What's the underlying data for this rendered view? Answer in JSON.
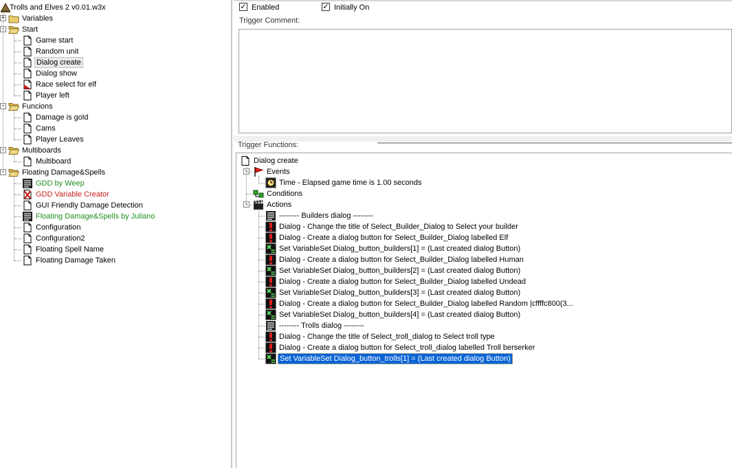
{
  "tree": {
    "root": "Trolls and Elves 2 v0.01.w3x",
    "items": [
      {
        "label": "Variables",
        "icon": "folder-icon",
        "depth": 1,
        "expander": "+"
      },
      {
        "label": "Start",
        "icon": "folder-open-icon",
        "depth": 1,
        "expander": "-"
      },
      {
        "label": "Game start",
        "icon": "document-icon",
        "depth": 2
      },
      {
        "label": "Random unit",
        "icon": "document-icon",
        "depth": 2
      },
      {
        "label": "Dialog create",
        "icon": "document-icon",
        "depth": 2,
        "selected": true
      },
      {
        "label": "Dialog show",
        "icon": "document-icon",
        "depth": 2
      },
      {
        "label": "Race select for elf",
        "icon": "document-disabled-icon",
        "depth": 2
      },
      {
        "label": "Player left",
        "icon": "document-icon",
        "depth": 2
      },
      {
        "label": "Funcions",
        "icon": "folder-open-icon",
        "depth": 1,
        "expander": "-"
      },
      {
        "label": "Damage is gold",
        "icon": "document-icon",
        "depth": 2
      },
      {
        "label": "Cams",
        "icon": "document-icon",
        "depth": 2
      },
      {
        "label": "Player Leaves",
        "icon": "document-icon",
        "depth": 2
      },
      {
        "label": "Multiboards",
        "icon": "folder-open-icon",
        "depth": 1,
        "expander": "-"
      },
      {
        "label": "Multiboard",
        "icon": "document-icon",
        "depth": 2
      },
      {
        "label": "Floating Damage&Spells",
        "icon": "folder-open-icon",
        "depth": 1,
        "expander": "-"
      },
      {
        "label": "GDD by Weep",
        "icon": "comment-lines-icon",
        "depth": 2,
        "color": "green"
      },
      {
        "label": "GDD Variable Creator",
        "icon": "disabled-trigger-icon",
        "depth": 2,
        "color": "red"
      },
      {
        "label": "GUI Friendly Damage Detection",
        "icon": "document-icon",
        "depth": 2
      },
      {
        "label": "Floating Damage&Spells by Juliano",
        "icon": "comment-lines-icon",
        "depth": 2,
        "color": "green"
      },
      {
        "label": "Configuration",
        "icon": "document-icon",
        "depth": 2
      },
      {
        "label": "Configuration2",
        "icon": "document-icon",
        "depth": 2
      },
      {
        "label": "Floating Spell Name",
        "icon": "document-icon",
        "depth": 2
      },
      {
        "label": "Floating Damage Taken",
        "icon": "document-icon",
        "depth": 2
      }
    ]
  },
  "options": {
    "enabled_label": "Enabled",
    "enabled": true,
    "initially_on_label": "Initially On",
    "initially_on": true
  },
  "comment": {
    "label": "Trigger Comment:",
    "value": ""
  },
  "functions": {
    "label": "Trigger Functions:",
    "rows": [
      {
        "label": "Dialog create",
        "icon": "document-icon",
        "depth": 0
      },
      {
        "label": "Events",
        "icon": "flag-icon",
        "depth": 1,
        "expander": "-"
      },
      {
        "label": "Time - Elapsed game time is 1.00 seconds",
        "icon": "clock-icon",
        "depth": 2
      },
      {
        "label": "Conditions",
        "icon": "conditions-icon",
        "depth": 1
      },
      {
        "label": "Actions",
        "icon": "clapper-icon",
        "depth": 1,
        "expander": "-"
      },
      {
        "label": "-------- Builders dialog --------",
        "icon": "comment-lines-icon",
        "depth": 2
      },
      {
        "label": "Dialog - Change the title of Select_Builder_Dialog to Select your builder",
        "icon": "exclamation-icon",
        "depth": 2
      },
      {
        "label": "Dialog - Create a dialog button for Select_Builder_Dialog labelled Elf",
        "icon": "exclamation-icon",
        "depth": 2
      },
      {
        "label": "Set VariableSet Dialog_button_builders[1] = (Last created dialog Button)",
        "icon": "set-variable-icon",
        "depth": 2
      },
      {
        "label": "Dialog - Create a dialog button for Select_Builder_Dialog labelled Human",
        "icon": "exclamation-icon",
        "depth": 2
      },
      {
        "label": "Set VariableSet Dialog_button_builders[2] = (Last created dialog Button)",
        "icon": "set-variable-icon",
        "depth": 2
      },
      {
        "label": "Dialog - Create a dialog button for Select_Builder_Dialog labelled Undead",
        "icon": "exclamation-icon",
        "depth": 2
      },
      {
        "label": "Set VariableSet Dialog_button_builders[3] = (Last created dialog Button)",
        "icon": "set-variable-icon",
        "depth": 2
      },
      {
        "label": "Dialog - Create a dialog button for Select_Builder_Dialog labelled Random |cffffc800(3...",
        "icon": "exclamation-icon",
        "depth": 2
      },
      {
        "label": "Set VariableSet Dialog_button_builders[4] = (Last created dialog Button)",
        "icon": "set-variable-icon",
        "depth": 2
      },
      {
        "label": "-------- Trolls dialog --------",
        "icon": "comment-lines-icon",
        "depth": 2
      },
      {
        "label": "Dialog - Change the title of Select_troll_dialog to Select troll type",
        "icon": "exclamation-icon",
        "depth": 2
      },
      {
        "label": "Dialog - Create a dialog button for Select_troll_dialog labelled Troll berserker",
        "icon": "exclamation-icon",
        "depth": 2
      },
      {
        "label": "Set VariableSet Dialog_button_trolls[1] = (Last created dialog Button)",
        "icon": "set-variable-icon",
        "depth": 2,
        "selected": true
      }
    ]
  },
  "colors": {
    "green_text": "#1f8f1f",
    "red_text": "#c81e1e",
    "selection": "#0a64d6",
    "folder": "#e9cf6b"
  }
}
